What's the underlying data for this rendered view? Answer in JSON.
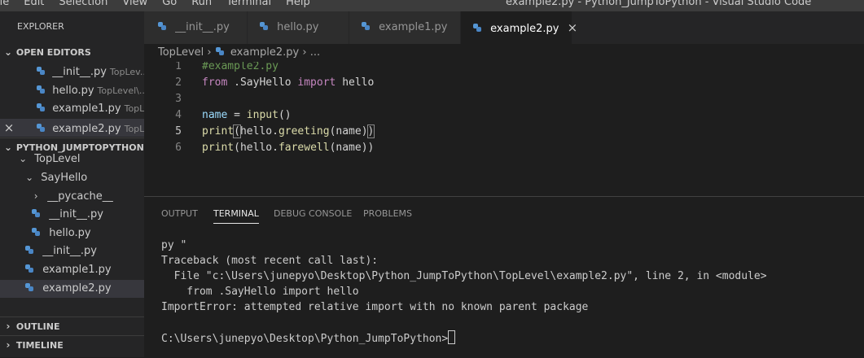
{
  "window": {
    "menu": [
      "ile",
      "Edit",
      "Selection",
      "View",
      "Go",
      "Run",
      "Terminal",
      "Help"
    ],
    "title": "example2.py - Python_JumpToPython - Visual Studio Code"
  },
  "explorer": {
    "title": "EXPLORER",
    "open_editors": {
      "label": "OPEN EDITORS",
      "items": [
        {
          "name": "__init__.py",
          "desc": "TopLev..."
        },
        {
          "name": "hello.py",
          "desc": "TopLevel\\..."
        },
        {
          "name": "example1.py",
          "desc": "TopL..."
        },
        {
          "name": "example2.py",
          "desc": "TopL...",
          "close": "×"
        }
      ]
    },
    "project": {
      "label": "PYTHON_JUMPTOPYTHON",
      "items": [
        {
          "name": "TopLevel"
        },
        {
          "name": "SayHello"
        },
        {
          "name": "__pycache__"
        },
        {
          "name": "__init__.py"
        },
        {
          "name": "hello.py"
        },
        {
          "name": "__init__.py"
        },
        {
          "name": "example1.py"
        },
        {
          "name": "example2.py"
        }
      ]
    },
    "outline_label": "OUTLINE",
    "timeline_label": "TIMELINE"
  },
  "tabs": [
    {
      "label": "__init__.py"
    },
    {
      "label": "hello.py"
    },
    {
      "label": "example1.py"
    },
    {
      "label": "example2.py",
      "close": "×"
    }
  ],
  "breadcrumb": {
    "folder": "TopLevel",
    "file": "example2.py",
    "tail": "..."
  },
  "editor": {
    "line_numbers": [
      "1",
      "2",
      "3",
      "4",
      "5",
      "6"
    ],
    "l1_comment": "#example2.py",
    "l2_from": "from",
    "l2_mod": " .SayHello ",
    "l2_import": "import",
    "l2_name": " hello",
    "l4_var": "name",
    "l4_eq": " = ",
    "l4_fn": "input",
    "l4_paren": "()",
    "l5_fn": "print",
    "l5_open": "(",
    "l5_mid": "hello.",
    "l5_call": "greeting",
    "l5_args": "(name)",
    "l5_close": ")",
    "l6_fn": "print",
    "l6_open": "(hello.",
    "l6_call": "farewell",
    "l6_args": "(name))"
  },
  "panel": {
    "tabs": [
      "OUTPUT",
      "TERMINAL",
      "DEBUG CONSOLE",
      "PROBLEMS"
    ],
    "terminal_lines": [
      "py \"",
      "Traceback (most recent call last):",
      "  File \"c:\\Users\\junepyo\\Desktop\\Python_JumpToPython\\TopLevel\\example2.py\", line 2, in <module>",
      "    from .SayHello import hello",
      "ImportError: attempted relative import with no known parent package",
      "",
      "C:\\Users\\junepyo\\Desktop\\Python_JumpToPython>"
    ]
  }
}
